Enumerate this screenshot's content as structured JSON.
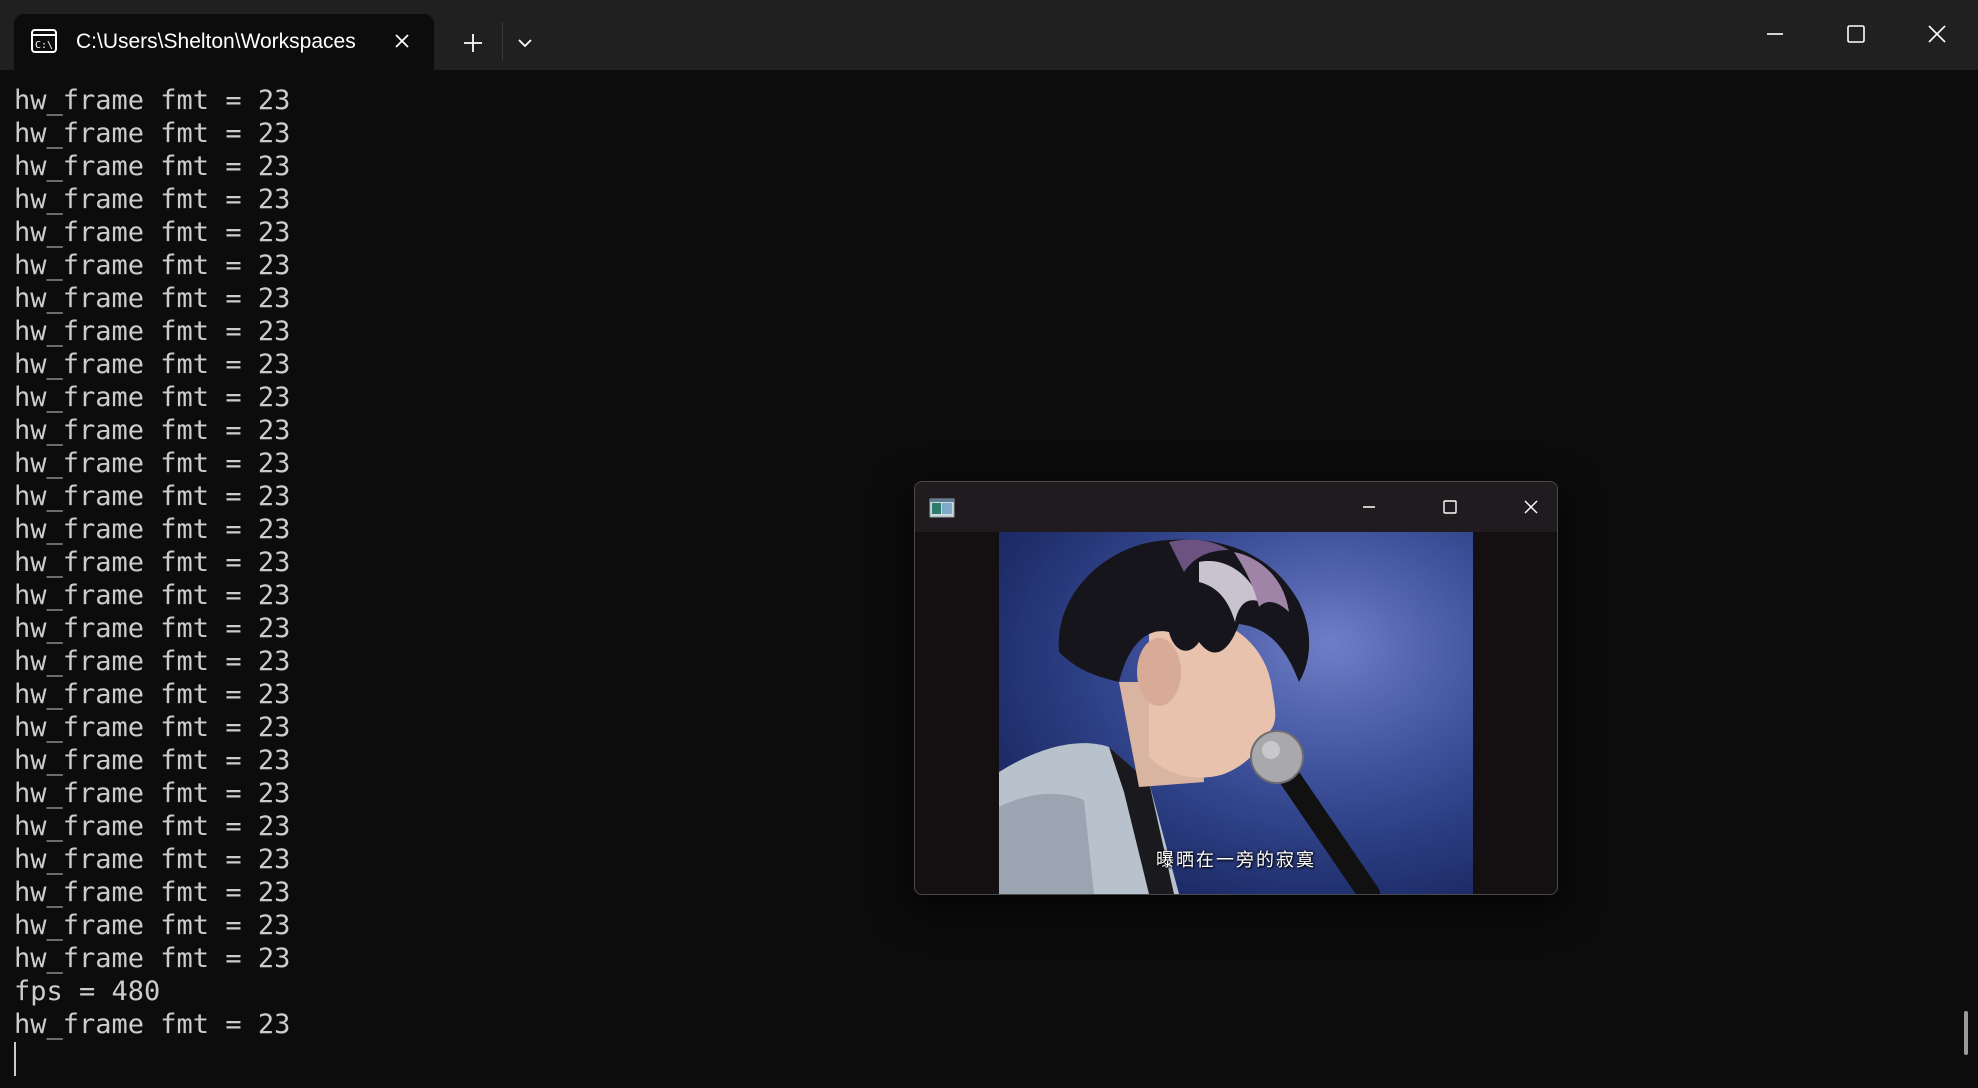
{
  "window": {
    "tab_title": "C:\\Users\\Shelton\\Workspaces",
    "tab_icon": "cmd-prompt-icon"
  },
  "terminal": {
    "lines": [
      "hw_frame fmt = 23",
      "hw_frame fmt = 23",
      "hw_frame fmt = 23",
      "hw_frame fmt = 23",
      "hw_frame fmt = 23",
      "hw_frame fmt = 23",
      "hw_frame fmt = 23",
      "hw_frame fmt = 23",
      "hw_frame fmt = 23",
      "hw_frame fmt = 23",
      "hw_frame fmt = 23",
      "hw_frame fmt = 23",
      "hw_frame fmt = 23",
      "hw_frame fmt = 23",
      "hw_frame fmt = 23",
      "hw_frame fmt = 23",
      "hw_frame fmt = 23",
      "hw_frame fmt = 23",
      "hw_frame fmt = 23",
      "hw_frame fmt = 23",
      "hw_frame fmt = 23",
      "hw_frame fmt = 23",
      "hw_frame fmt = 23",
      "hw_frame fmt = 23",
      "hw_frame fmt = 23",
      "hw_frame fmt = 23",
      "hw_frame fmt = 23",
      "fps = 480",
      "hw_frame fmt = 23"
    ]
  },
  "video_window": {
    "subtitle": "曝晒在一旁的寂寞"
  },
  "colors": {
    "background": "#0c0c0c",
    "titlebar": "#202020",
    "text": "#cccccc"
  }
}
